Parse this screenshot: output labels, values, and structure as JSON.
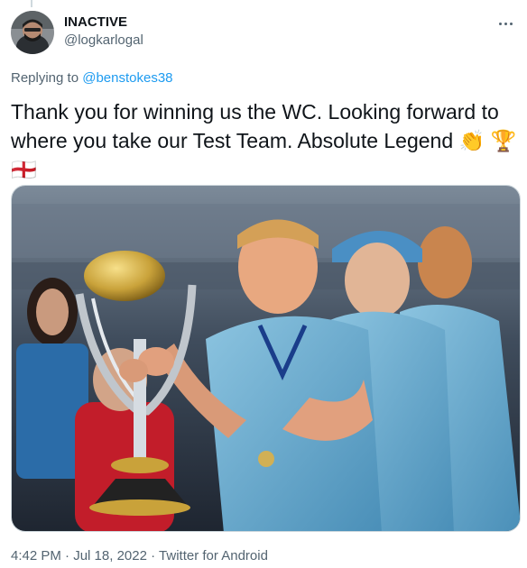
{
  "user": {
    "display_name": "INACTIVE",
    "handle": "@logkarlogal",
    "avatar_icon": "profile-avatar"
  },
  "reply": {
    "prefix": "Replying to",
    "to_handle": "@benstokes38"
  },
  "tweet": {
    "text": "Thank you for winning us the WC. Looking forward to where you take our Test Team. Absolute Legend 👏 🏆\n🏴󠁧󠁢󠁥󠁮󠁧󠁿",
    "emojis": [
      "clapping-hands-emoji",
      "trophy-emoji",
      "england-flag-emoji"
    ]
  },
  "media": {
    "icon": "photo-cricket-world-cup-trophy"
  },
  "meta": {
    "time": "4:42 PM",
    "date": "Jul 18, 2022",
    "separator": "·",
    "source": "Twitter for Android"
  },
  "colors": {
    "text": "#0f1419",
    "secondary": "#536471",
    "accent": "#1d9bf0"
  }
}
